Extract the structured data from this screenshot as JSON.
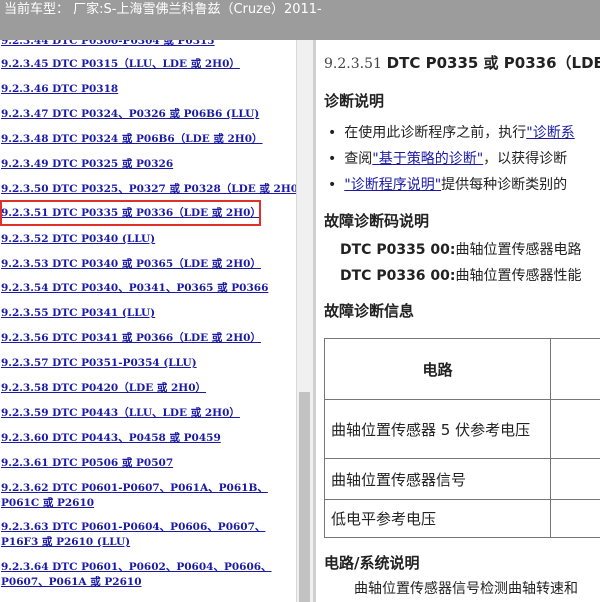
{
  "titlebar": {
    "text": "当前车型： 厂家:S-上海雪佛兰科鲁兹（Cruze）2011-"
  },
  "nav": {
    "items": [
      "9.2.3.44 DTC P0300-P0304 或 P0315",
      "9.2.3.45 DTC P0315（LLU、LDE 或 2H0）",
      "9.2.3.46 DTC P0318",
      "9.2.3.47 DTC P0324、P0326 或 P06B6 (LLU)",
      "9.2.3.48 DTC P0324 或 P06B6（LDE 或 2H0）",
      "9.2.3.49 DTC P0325 或 P0326",
      "9.2.3.50 DTC P0325、P0327 或 P0328（LDE 或 2H0）",
      "9.2.3.51 DTC P0335 或 P0336（LDE 或 2H0）",
      "9.2.3.52 DTC P0340 (LLU)",
      "9.2.3.53 DTC P0340 或 P0365（LDE 或 2H0）",
      "9.2.3.54 DTC P0340、P0341、P0365 或 P0366",
      "9.2.3.55 DTC P0341 (LLU)",
      "9.2.3.56 DTC P0341 或 P0366（LDE 或 2H0）",
      "9.2.3.57 DTC P0351-P0354 (LLU)",
      "9.2.3.58 DTC P0420（LDE 或 2H0）",
      "9.2.3.59 DTC P0443（LLU、LDE 或 2H0）",
      "9.2.3.60 DTC P0443、P0458 或 P0459",
      "9.2.3.61 DTC P0506 或 P0507",
      "9.2.3.62 DTC P0601-P0607、P061A、P061B、P061C 或 P2610",
      "9.2.3.63 DTC P0601-P0604、P0606、P0607、P16F3 或 P2610 (LLU)",
      "9.2.3.64 DTC P0601、P0602、P0604、P0606、P0607、P061A 或 P2610"
    ]
  },
  "content": {
    "number": "9.2.3.51",
    "title": "DTC P0335 或 P0336（LDE",
    "diag_heading": "诊断说明",
    "bullets": [
      {
        "pre": "在使用此诊断程序之前，执行",
        "link": "\"诊断系",
        "post": ""
      },
      {
        "pre": "查阅",
        "link": "\"基于策略的诊断\"",
        "post": "，以获得诊断"
      },
      {
        "pre": "",
        "link": "\"诊断程序说明\"",
        "post": "提供每种诊断类别的"
      }
    ],
    "dtc_heading": "故障诊断码说明",
    "dtcs": [
      {
        "code": "DTC P0335 00:",
        "desc": "曲轴位置传感器电路"
      },
      {
        "code": "DTC P0336 00:",
        "desc": "曲轴位置传感器性能"
      }
    ],
    "info_heading": "故障诊断信息",
    "table": {
      "header": "电路",
      "rows": [
        "曲轴位置传感器 5 伏参考电压",
        "曲轴位置传感器信号",
        "低电平参考电压"
      ]
    },
    "sys_heading": "电路/系统说明",
    "sys_text": "曲轴位置传感器信号检测曲轴转速和"
  }
}
